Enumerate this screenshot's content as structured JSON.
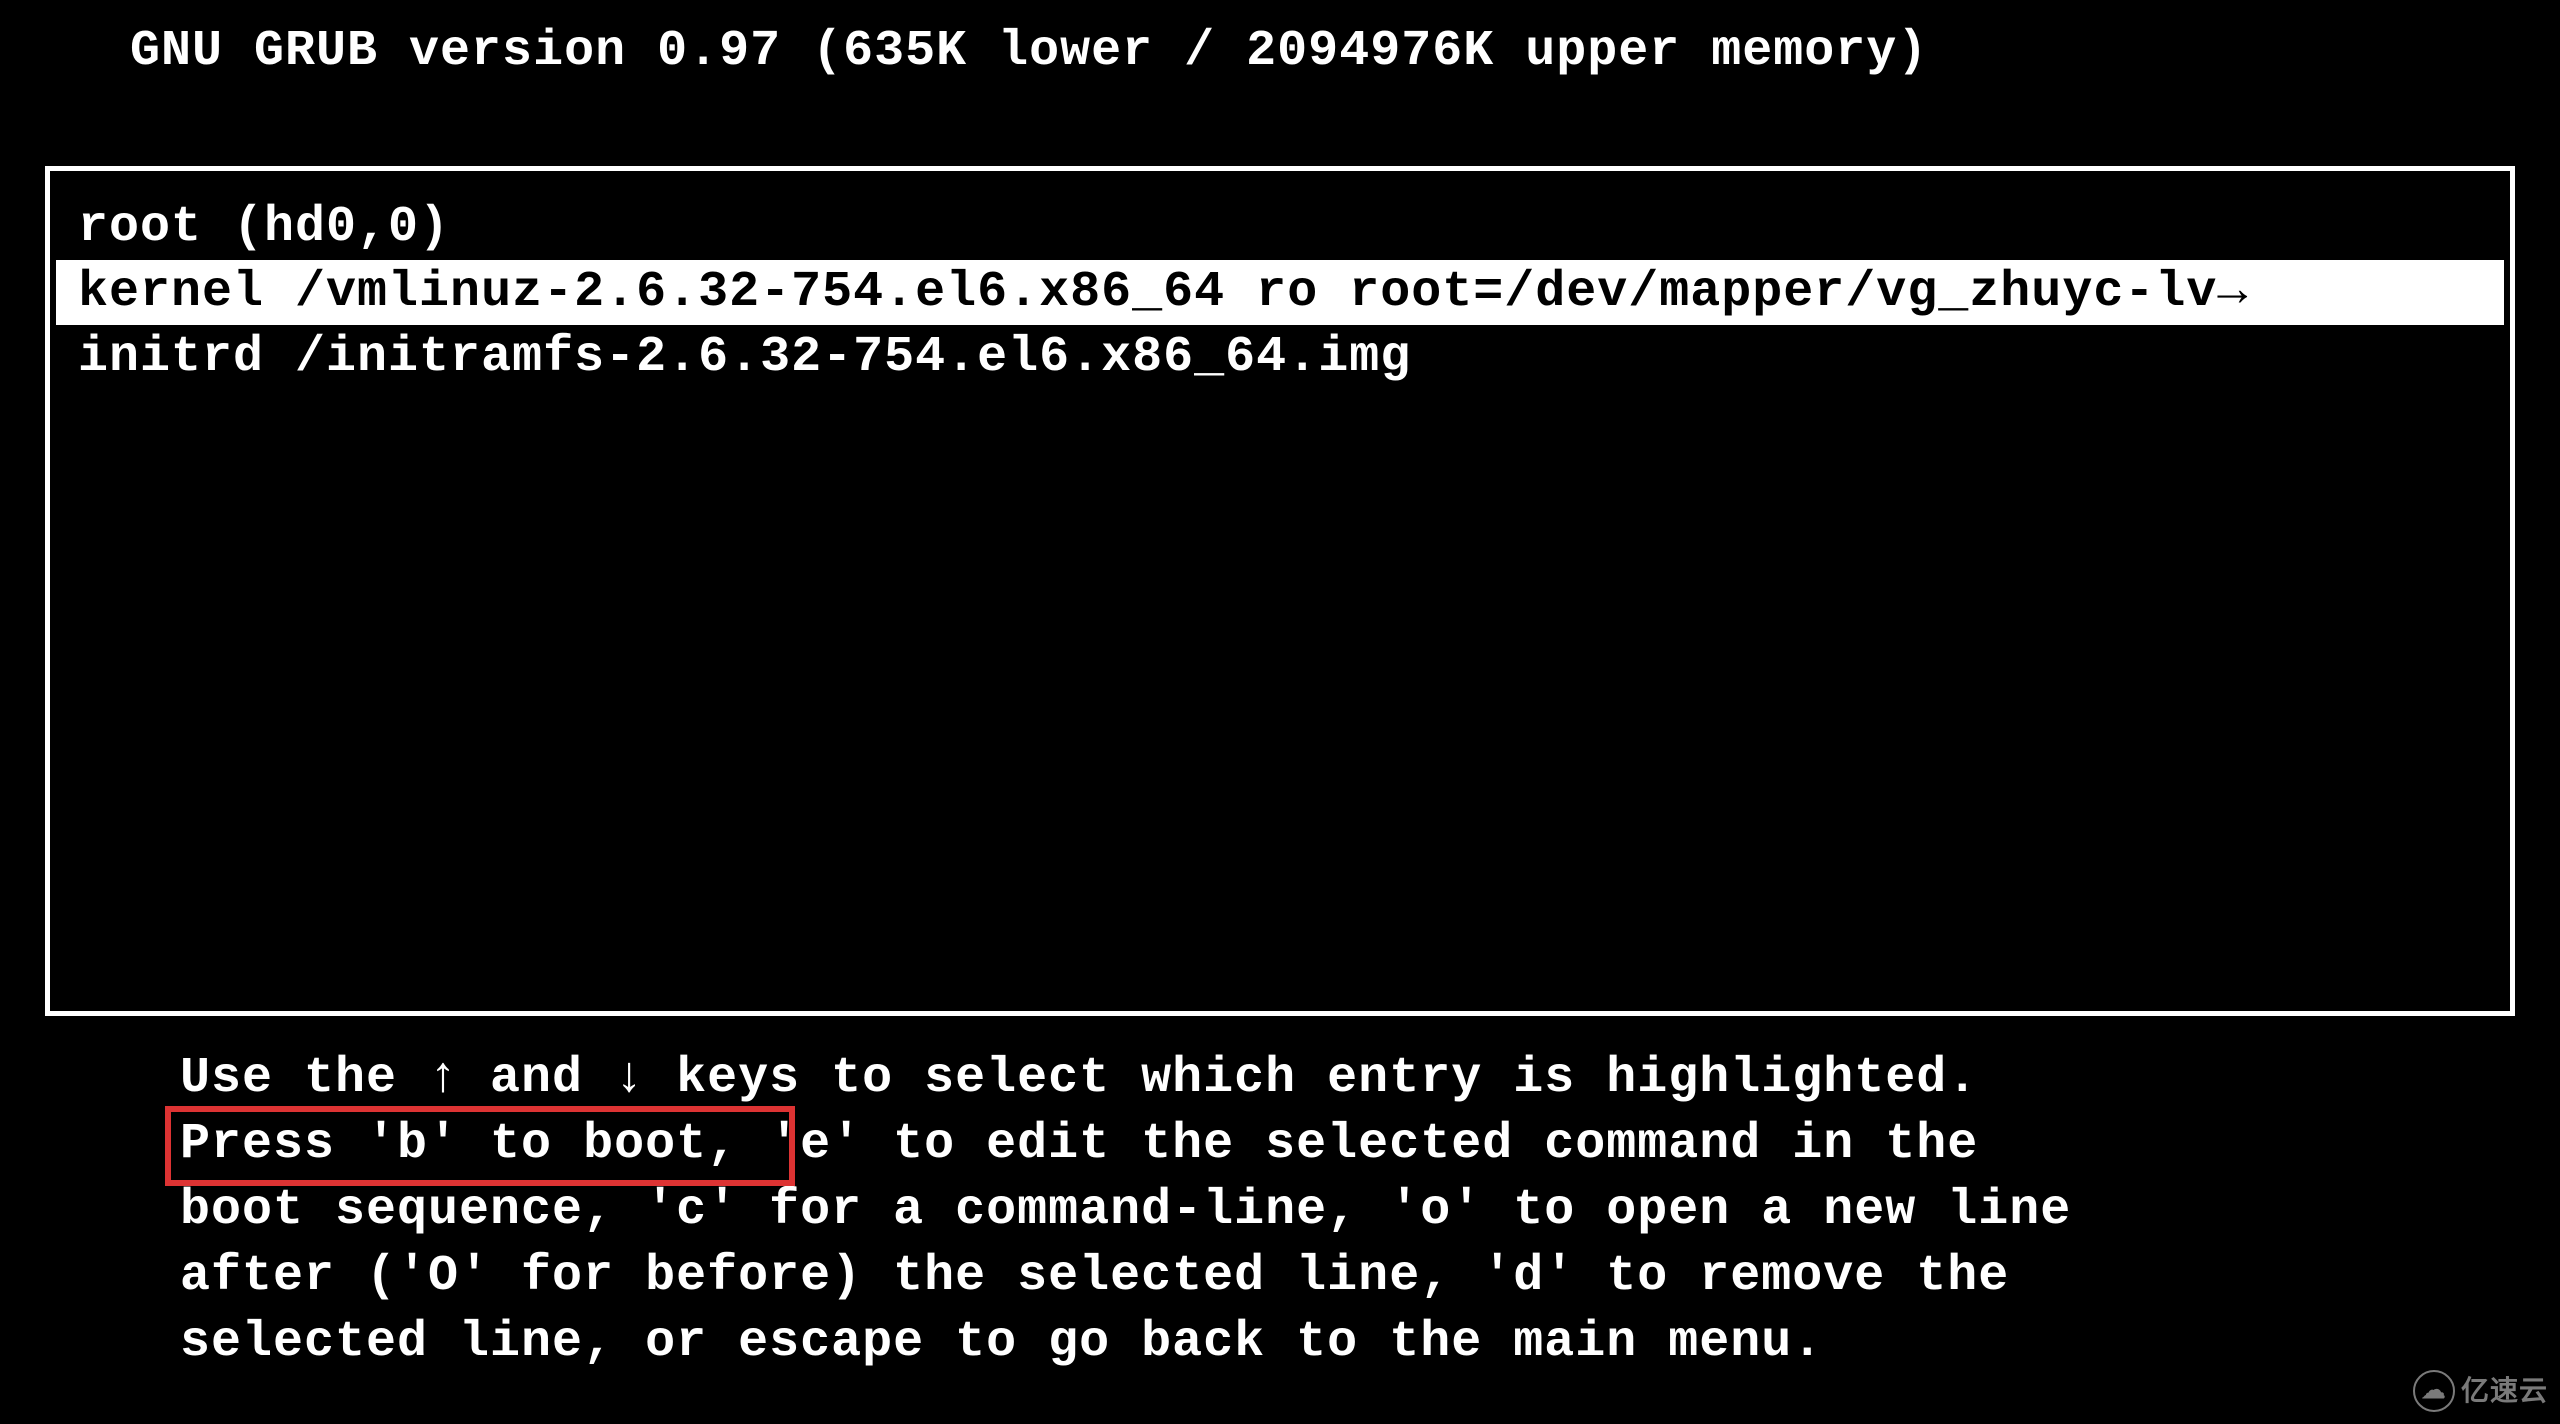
{
  "header": {
    "title": "GNU GRUB  version 0.97  (635K lower / 2094976K upper memory)"
  },
  "menu": {
    "lines": [
      "root (hd0,0)",
      "kernel /vmlinuz-2.6.32-754.el6.x86_64 ro root=/dev/mapper/vg_zhuyc-lv→",
      "initrd /initramfs-2.6.32-754.el6.x86_64.img"
    ],
    "selected_index": 1
  },
  "instructions": {
    "line1": "Use the ↑ and ↓ keys to select which entry is highlighted.",
    "line2": "Press 'b' to boot, 'e' to edit the selected command in the",
    "line3": "boot sequence, 'c' for a command-line, 'o' to open a new line",
    "line4": "after ('O' for before) the selected line, 'd' to remove the",
    "line5": "selected line, or escape to go back to the main menu."
  },
  "highlight": {
    "text": "Press 'b' to boot,"
  },
  "watermark": {
    "text": "亿速云"
  }
}
